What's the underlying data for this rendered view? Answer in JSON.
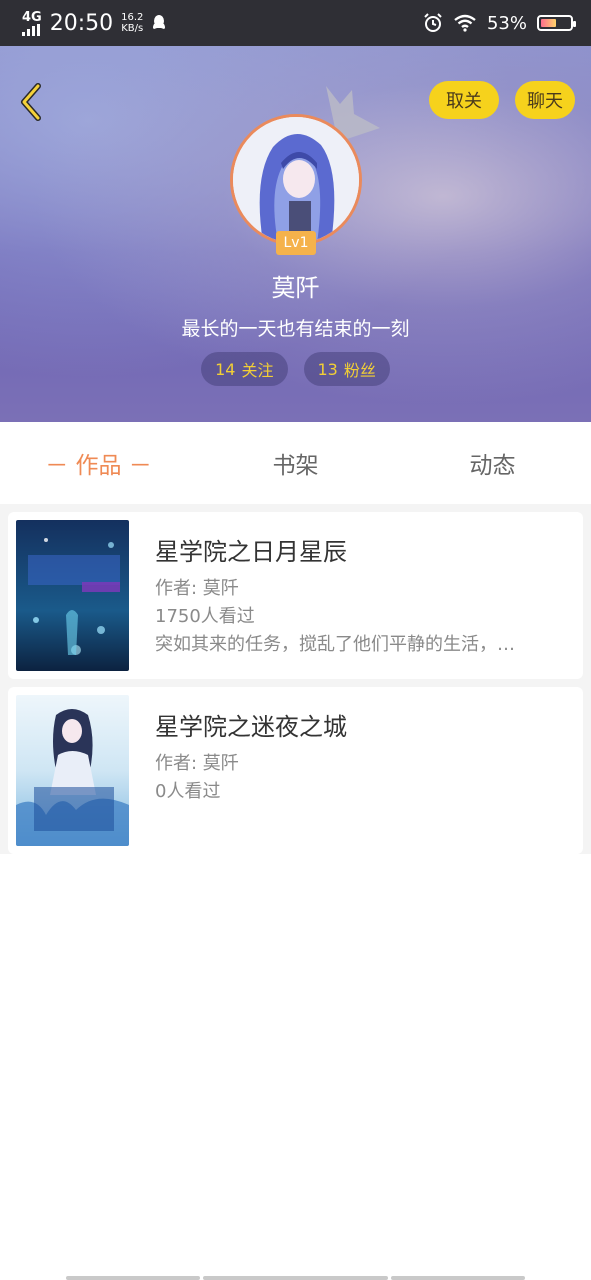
{
  "status_bar": {
    "network": "4G",
    "time": "20:50",
    "speed_value": "16.2",
    "speed_unit": "KB/s",
    "battery": "53%",
    "battery_level": 0.53,
    "icons": [
      "signal-icon",
      "qq-icon",
      "alarm-icon",
      "wifi-icon",
      "battery-icon"
    ]
  },
  "header": {
    "actions": {
      "unfollow": "取关",
      "chat": "聊天"
    },
    "level": "Lv1",
    "username": "莫阡",
    "signature": "最长的一天也有结束的一刻",
    "follow_count": "14",
    "follow_label": "关注",
    "fans_count": "13",
    "fans_label": "粉丝"
  },
  "tabs": [
    {
      "label": "－ 作品 －",
      "active": true
    },
    {
      "label": "书架",
      "active": false
    },
    {
      "label": "动态",
      "active": false
    }
  ],
  "books": [
    {
      "title": "星学院之日月星辰",
      "author": "作者: 莫阡",
      "views": "1750人看过",
      "summary": "突如其来的任务，搅乱了他们平静的生活，…"
    },
    {
      "title": "星学院之迷夜之城",
      "author": "作者: 莫阡",
      "views": "0人看过",
      "summary": ""
    }
  ],
  "colors": {
    "accent_orange": "#ef8a54",
    "button_yellow": "#f6d21c",
    "stat_yellow": "#f2cf36",
    "level_badge": "#f5b24b"
  }
}
